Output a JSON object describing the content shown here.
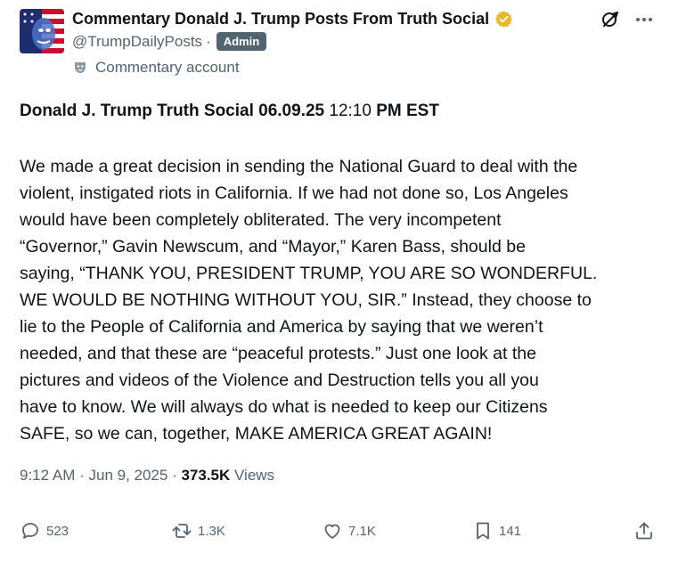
{
  "author": {
    "display_name": "Commentary Donald J. Trump Posts From Truth Social",
    "handle": "@TrumpDailyPosts",
    "separator": "·",
    "badge": "Admin",
    "account_label": "Commentary account",
    "verified_color": "#e8b829"
  },
  "post": {
    "title_bold": "Donald J. Trump Truth Social 06.09.25",
    "title_time": " 12:10 ",
    "title_bold_end": "PM EST",
    "body_lines": [
      "We made a great decision in sending the National Guard to deal with the",
      "violent, instigated riots in California. If we had not done so, Los Angeles",
      "would have been completely obliterated. The very incompetent",
      "“Governor,”  Gavin Newscum, and “Mayor,” Karen Bass, should be",
      "saying, “THANK YOU, PRESIDENT TRUMP, YOU ARE SO WONDERFUL.",
      "WE WOULD BE NOTHING WITHOUT YOU, SIR.” Instead, they choose to",
      "lie to the People of California and America by saying that we weren’t",
      "needed, and that these are “peaceful protests.” Just one look at the",
      "pictures and videos of the Violence and Destruction tells you all you",
      "have to know. We will always do what is needed to keep our Citizens",
      "SAFE, so we can, together, MAKE AMERICA GREAT AGAIN!"
    ]
  },
  "meta": {
    "time": "9:12 AM",
    "dot1": " · ",
    "date": "Jun 9, 2025",
    "dot2": " · ",
    "views_count": "373.5K",
    "views_label": " Views"
  },
  "actions": {
    "replies": "523",
    "reposts": "1.3K",
    "likes": "7.1K",
    "bookmarks": "141"
  },
  "colors": {
    "text": "#0f1419",
    "secondary": "#536471",
    "badge_bg": "#536471"
  },
  "icons": {
    "verified": "verified-badge-icon",
    "grok": "grok-icon",
    "more": "more-icon",
    "account_label": "commentary-mask-icon",
    "reply": "reply-icon",
    "repost": "repost-icon",
    "like": "like-icon",
    "bookmark": "bookmark-icon",
    "share": "share-icon"
  }
}
